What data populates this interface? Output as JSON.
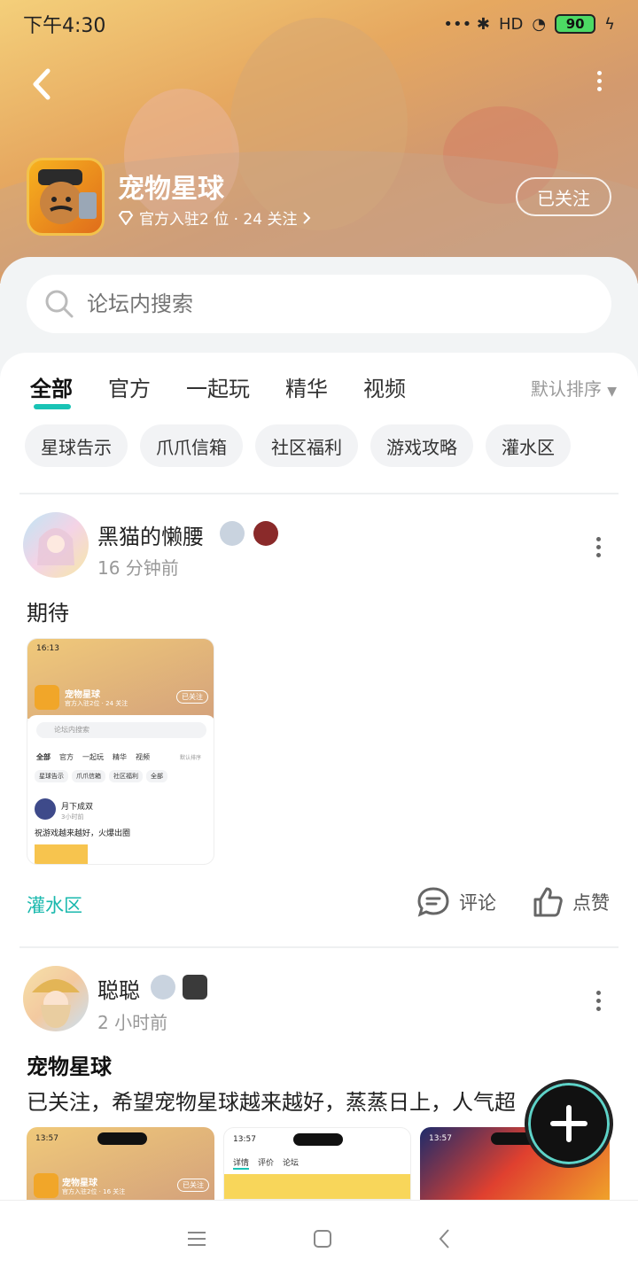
{
  "status_bar": {
    "time": "下午4:30",
    "network": "HD",
    "battery": "90"
  },
  "header": {
    "game_name": "宠物星球",
    "subtitle": "官方入驻2 位 · 24 关注",
    "follow_label": "已关注"
  },
  "search": {
    "placeholder": "论坛内搜索"
  },
  "tabs": [
    {
      "label": "全部"
    },
    {
      "label": "官方"
    },
    {
      "label": "一起玩"
    },
    {
      "label": "精华"
    },
    {
      "label": "视频"
    }
  ],
  "sort_label": "默认排序",
  "chips": [
    {
      "label": "星球告示"
    },
    {
      "label": "爪爪信箱"
    },
    {
      "label": "社区福利"
    },
    {
      "label": "游戏攻略"
    },
    {
      "label": "灌水区"
    }
  ],
  "posts": [
    {
      "username": "黑猫的懒腰",
      "time": "16 分钟前",
      "text": "期待",
      "tag": "灌水区",
      "comment_label": "评论",
      "like_label": "点赞",
      "screenshot": {
        "time": "16:13",
        "game_name": "宠物星球",
        "subtitle": "官方入驻2位 · 24 关注",
        "follow": "已关注",
        "search": "论坛内搜索",
        "tabs": [
          "全部",
          "官方",
          "一起玩",
          "精华",
          "视频"
        ],
        "sort": "默认排序",
        "chips": [
          "星球告示",
          "爪爪信箱",
          "社区福利",
          "全部"
        ],
        "user": "月下成双",
        "user_time": "3小时前",
        "post_text": "祝游戏越来越好，火爆出圈"
      }
    },
    {
      "username": "聪聪",
      "time": "2 小时前",
      "title": "宠物星球",
      "text": "已关注，希望宠物星球越来越好，蒸蒸日上，人气超",
      "thumb1": {
        "time": "13:57",
        "game_name": "宠物星球",
        "subtitle": "官方入驻2位 · 16 关注",
        "follow": "已关注"
      },
      "thumb2": {
        "time": "13:57",
        "tabs": [
          "详情",
          "评价",
          "论坛"
        ]
      },
      "thumb3": {
        "time": "13:57"
      }
    }
  ]
}
